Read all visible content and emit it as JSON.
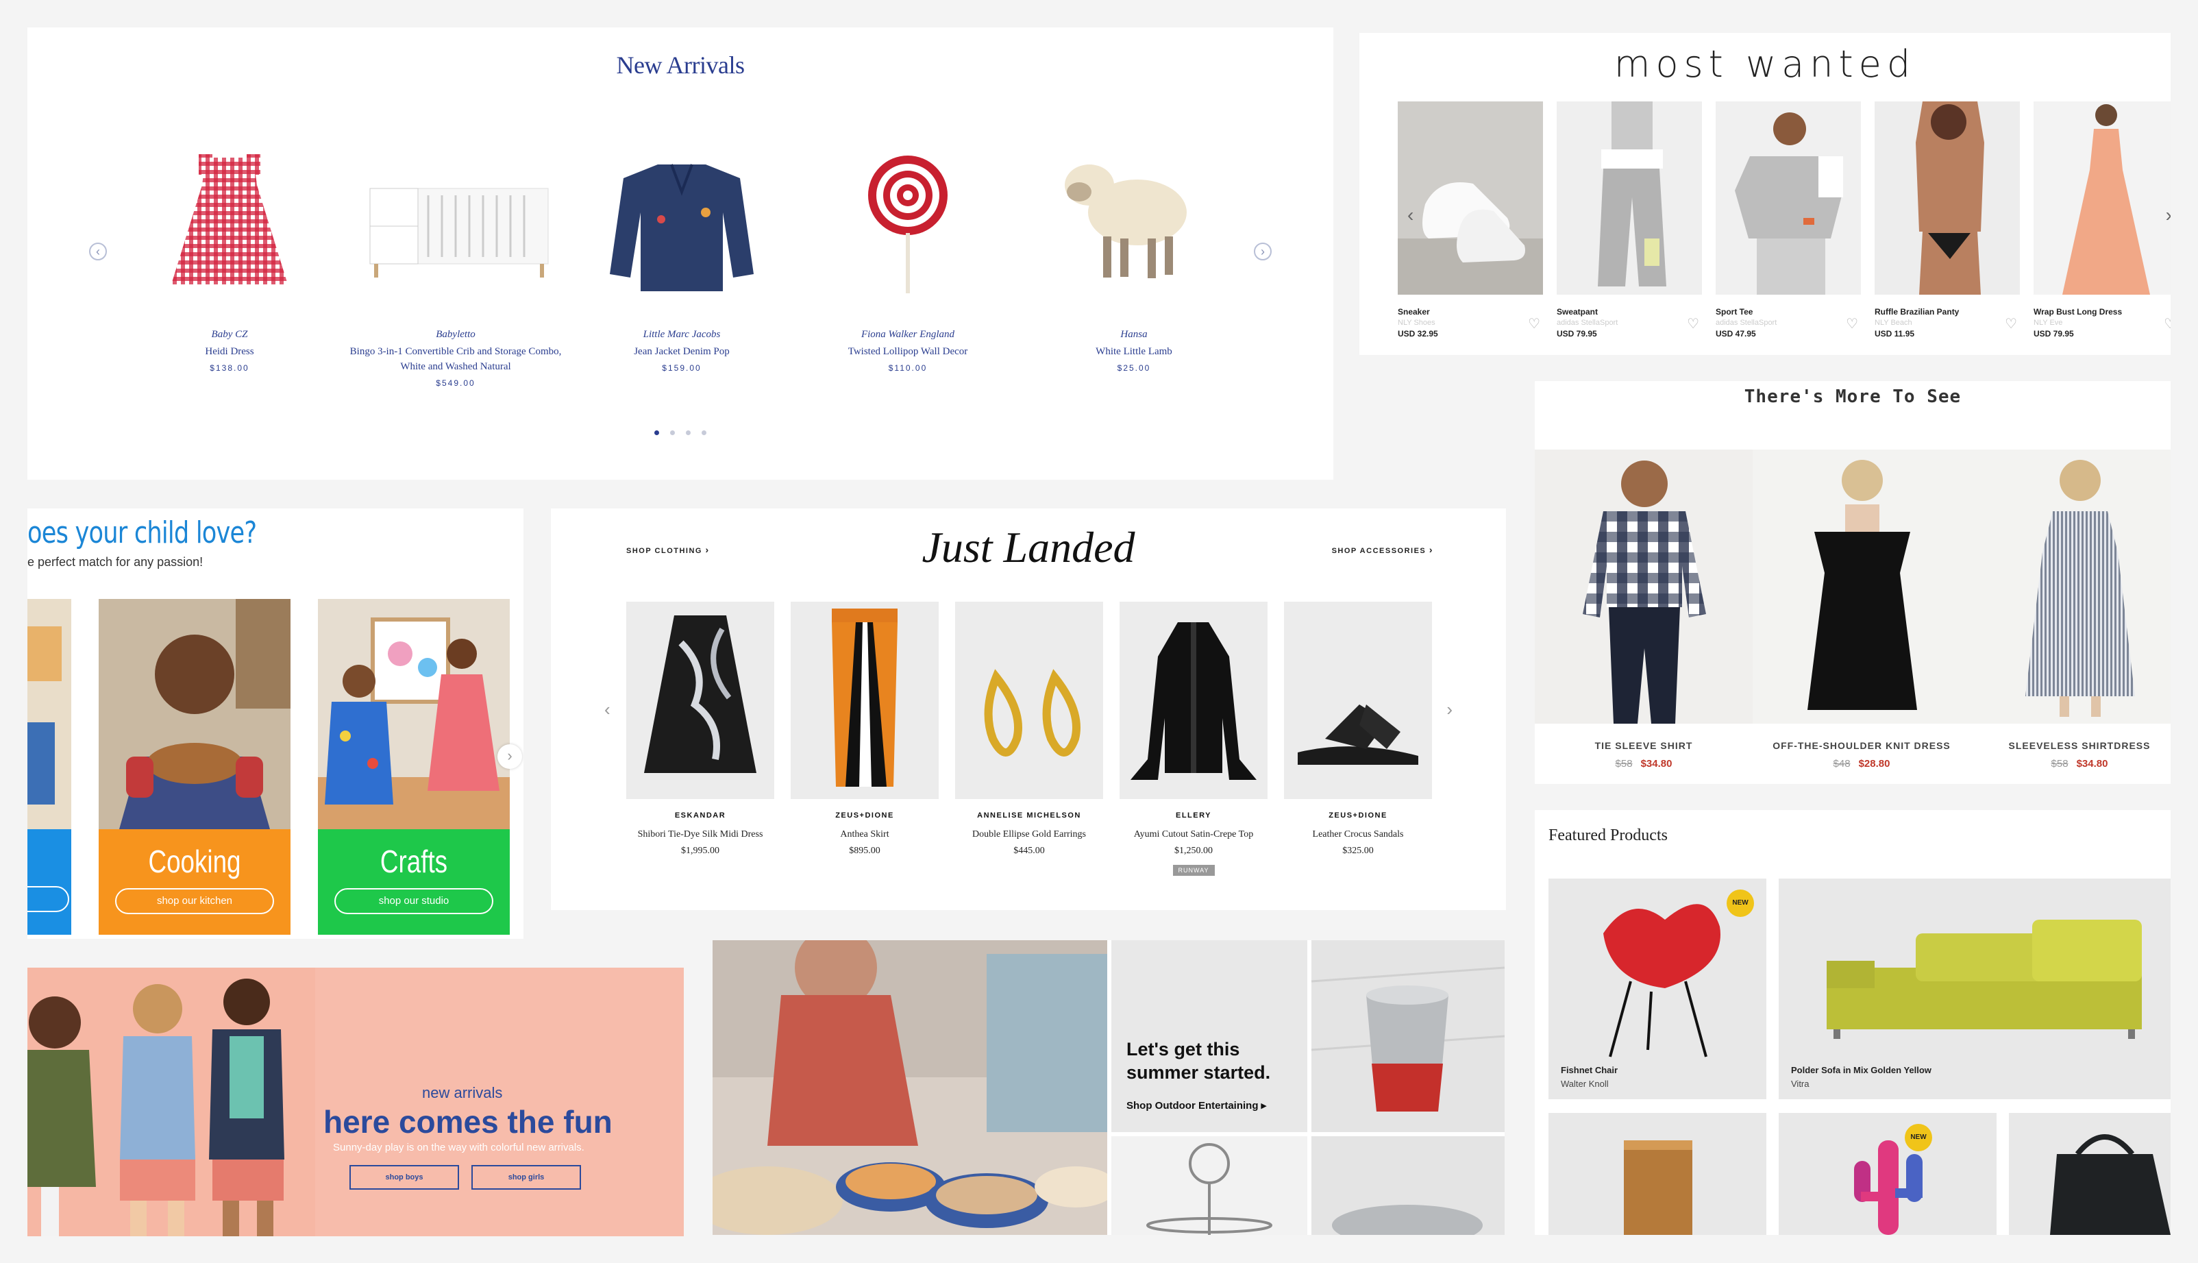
{
  "new_arrivals": {
    "title": "New Arrivals",
    "items": [
      {
        "brand": "Baby CZ",
        "name": "Heidi Dress",
        "price": "$138.00"
      },
      {
        "brand": "Babyletto",
        "name": "Bingo 3-in-1 Convertible Crib and Storage Combo, White and Washed Natural",
        "price": "$549.00"
      },
      {
        "brand": "Little Marc Jacobs",
        "name": "Jean Jacket Denim Pop",
        "price": "$159.00"
      },
      {
        "brand": "Fiona Walker England",
        "name": "Twisted Lollipop Wall Decor",
        "price": "$110.00"
      },
      {
        "brand": "Hansa",
        "name": "White Little Lamb",
        "price": "$25.00"
      }
    ],
    "prev_icon": "chevron-left-icon",
    "next_icon": "chevron-right-icon",
    "pages": 4,
    "active_page": 1
  },
  "most_wanted": {
    "title": "most wanted",
    "items": [
      {
        "name": "Sneaker",
        "brand": "NLY Shoes",
        "price": "USD 32.95"
      },
      {
        "name": "Sweatpant",
        "brand": "adidas StellaSport",
        "price": "USD 79.95"
      },
      {
        "name": "Sport Tee",
        "brand": "adidas StellaSport",
        "price": "USD 47.95"
      },
      {
        "name": "Ruffle Brazilian Panty",
        "brand": "NLY Beach",
        "price": "USD 11.95"
      },
      {
        "name": "Wrap Bust Long Dress",
        "brand": "NLY Eve",
        "price": "USD 79.95"
      }
    ],
    "heart_icon": "heart-icon"
  },
  "more_to_see": {
    "title": "There's More To See",
    "items": [
      {
        "name": "TIE SLEEVE SHIRT",
        "old_price": "$58",
        "price": "$34.80"
      },
      {
        "name": "OFF-THE-SHOULDER KNIT DRESS",
        "old_price": "$48",
        "price": "$28.80"
      },
      {
        "name": "SLEEVELESS SHIRTDRESS",
        "old_price": "$58",
        "price": "$34.80"
      }
    ],
    "sale_color": "#c0392b"
  },
  "featured": {
    "title": "Featured Products",
    "items": [
      {
        "name": "Fishnet Chair",
        "brand": "Walter Knoll",
        "badge": "NEW"
      },
      {
        "name": "Polder Sofa in Mix Golden Yellow",
        "brand": "Vitra",
        "badge": ""
      },
      {
        "name": "",
        "brand": "",
        "badge": ""
      },
      {
        "name": "",
        "brand": "",
        "badge": "NEW"
      },
      {
        "name": "",
        "brand": "",
        "badge": ""
      }
    ]
  },
  "child_love": {
    "title": "oes your child love?",
    "subtitle": "e perfect match for any passion!",
    "tiles": [
      {
        "label": "Cooking",
        "button": "shop our kitchen",
        "color": "#f7941d"
      },
      {
        "label": "Crafts",
        "button": "shop our studio",
        "color": "#1ec84a"
      }
    ],
    "next_icon": "chevron-right-icon"
  },
  "just_landed": {
    "title": "Just Landed",
    "left_link": "SHOP CLOTHING",
    "right_link": "SHOP ACCESSORIES",
    "items": [
      {
        "brand": "ESKANDAR",
        "name": "Shibori Tie-Dye Silk Midi Dress",
        "price": "$1,995.00",
        "tag": ""
      },
      {
        "brand": "ZEUS+DIONE",
        "name": "Anthea Skirt",
        "price": "$895.00",
        "tag": ""
      },
      {
        "brand": "ANNELISE MICHELSON",
        "name": "Double Ellipse Gold Earrings",
        "price": "$445.00",
        "tag": ""
      },
      {
        "brand": "ELLERY",
        "name": "Ayumi Cutout Satin-Crepe Top",
        "price": "$1,250.00",
        "tag": "RUNWAY"
      },
      {
        "brand": "ZEUS+DIONE",
        "name": "Leather Crocus Sandals",
        "price": "$325.00",
        "tag": ""
      }
    ]
  },
  "kids_banner": {
    "eyebrow": "new arrivals",
    "headline": "here comes the fun",
    "line": "Sunny-day play is on the way with colorful new arrivals.",
    "buttons": [
      "shop boys",
      "shop girls"
    ],
    "accent": "#2b4a9c"
  },
  "summer": {
    "headline": "Let's get this summer started.",
    "link": "Shop Outdoor Entertaining"
  }
}
